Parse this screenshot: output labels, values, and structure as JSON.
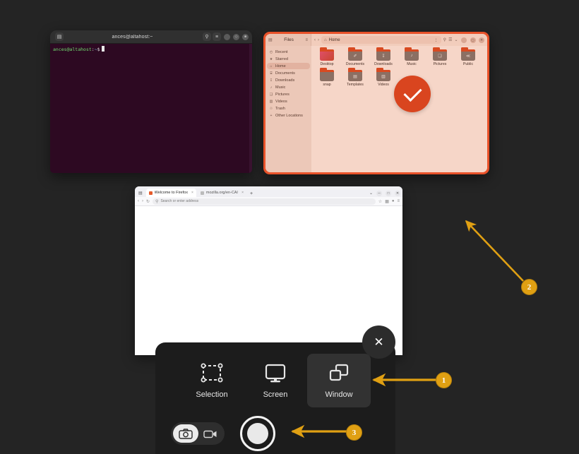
{
  "desktop": {
    "background_color": "#242424"
  },
  "terminal": {
    "title": "ances@altahost:~",
    "prompt_user": "ances@altahost",
    "prompt_colon": ":",
    "prompt_path": "~",
    "prompt_dollar": "$",
    "icons": {
      "app": "terminal-icon",
      "search": "search-icon",
      "menu": "hamburger-menu-icon"
    },
    "window_controls": [
      "minimize",
      "maximize",
      "close"
    ],
    "background_color": "#2d0922"
  },
  "file_manager": {
    "app_title": "Files",
    "path_label": "Home",
    "accent_color": "#e8522a",
    "sidebar": [
      {
        "label": "Recent",
        "icon": "clock-icon",
        "selected": false
      },
      {
        "label": "Starred",
        "icon": "star-icon",
        "selected": false
      },
      {
        "label": "Home",
        "icon": "home-icon",
        "selected": true
      },
      {
        "label": "Documents",
        "icon": "document-icon",
        "selected": false
      },
      {
        "label": "Downloads",
        "icon": "download-icon",
        "selected": false
      },
      {
        "label": "Music",
        "icon": "music-icon",
        "selected": false
      },
      {
        "label": "Pictures",
        "icon": "image-icon",
        "selected": false
      },
      {
        "label": "Videos",
        "icon": "video-icon",
        "selected": false
      },
      {
        "label": "Trash",
        "icon": "trash-icon",
        "selected": false
      },
      {
        "label": "Other Locations",
        "icon": "plus-icon",
        "selected": false
      }
    ],
    "files": [
      {
        "name": "Desktop",
        "glyph": ""
      },
      {
        "name": "Documents",
        "glyph": "✐"
      },
      {
        "name": "Downloads",
        "glyph": "↧"
      },
      {
        "name": "Music",
        "glyph": "♪"
      },
      {
        "name": "Pictures",
        "glyph": "❑"
      },
      {
        "name": "Public",
        "glyph": "≪"
      },
      {
        "name": "snap",
        "glyph": ""
      },
      {
        "name": "Templates",
        "glyph": "▤"
      },
      {
        "name": "Videos",
        "glyph": "▥"
      }
    ],
    "selection_indicator": "checkmark-icon",
    "toolbar_icons": [
      "menu-icon",
      "view-options-icon",
      "back-icon",
      "forward-icon",
      "search-icon",
      "list-view-icon",
      "sort-icon"
    ]
  },
  "browser": {
    "tabs": [
      {
        "title": "Welcome to Firefox",
        "active": true,
        "favicon": "firefox-icon"
      },
      {
        "title": "mozilla.org/en-CA/",
        "active": false,
        "favicon": "globe-icon"
      }
    ],
    "new_tab_label": "+",
    "url_placeholder": "Search or enter address",
    "nav_icons": [
      "back-icon",
      "forward-icon",
      "reload-icon"
    ],
    "toolbar_icons": [
      "bookmark-icon",
      "account-icon",
      "extensions-icon",
      "hamburger-menu-icon"
    ],
    "window_controls": [
      "minimize",
      "maximize",
      "close"
    ]
  },
  "screenshot_tool": {
    "modes": [
      {
        "label": "Selection",
        "icon": "selection-icon",
        "selected": false
      },
      {
        "label": "Screen",
        "icon": "screen-icon",
        "selected": false
      },
      {
        "label": "Window",
        "icon": "window-icon",
        "selected": true
      }
    ],
    "capture_type": {
      "photo": {
        "icon": "camera-icon",
        "selected": true
      },
      "video": {
        "icon": "video-camera-icon",
        "selected": false
      }
    },
    "shutter": "capture-button",
    "close": "close-icon"
  },
  "annotations": [
    {
      "number": "1",
      "color": "#e0a013",
      "points_to": "window-mode-button"
    },
    {
      "number": "2",
      "color": "#e0a013",
      "points_to": "desktop-background"
    },
    {
      "number": "3",
      "color": "#e0a013",
      "points_to": "capture-shutter-button"
    }
  ]
}
